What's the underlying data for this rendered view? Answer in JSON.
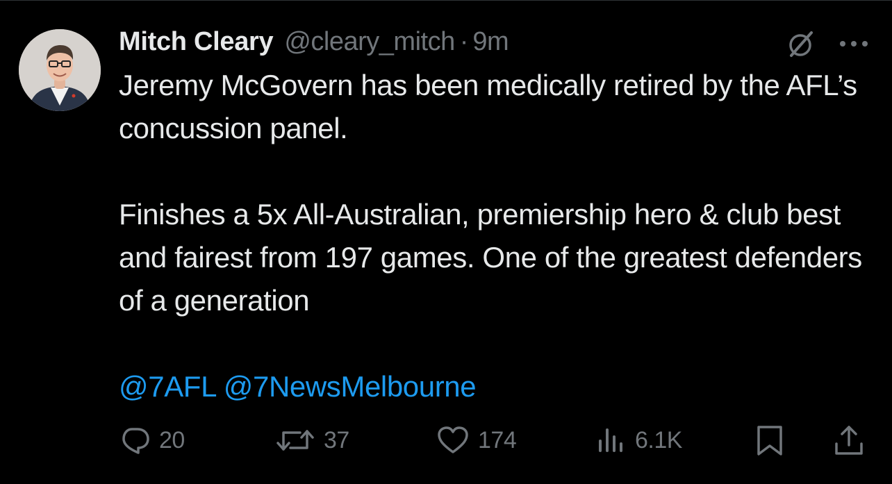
{
  "tweet": {
    "author_name": "Mitch Cleary",
    "author_handle": "@cleary_mitch",
    "separator": "·",
    "timestamp": "9m",
    "text_line1": "Jeremy McGovern has been medically retired by the AFL’s concussion panel.",
    "text_line2": "Finishes a 5x All-Australian, premiership hero & club best and fairest from 197 games. One of the greatest defenders of a generation",
    "mentions": [
      "@7AFL",
      "@7NewsMelbourne"
    ]
  },
  "actions": {
    "replies": "20",
    "reposts": "37",
    "likes": "174",
    "views": "6.1K"
  },
  "icons": {
    "avatar": "profile-photo",
    "grok": "grok-icon",
    "more": "more-icon",
    "reply": "reply-icon",
    "repost": "repost-icon",
    "like": "heart-icon",
    "views": "views-icon",
    "bookmark": "bookmark-icon",
    "share": "share-icon"
  },
  "colors": {
    "background": "#000000",
    "text": "#e7e9ea",
    "secondary": "#71767b",
    "link": "#1d9bf0"
  }
}
